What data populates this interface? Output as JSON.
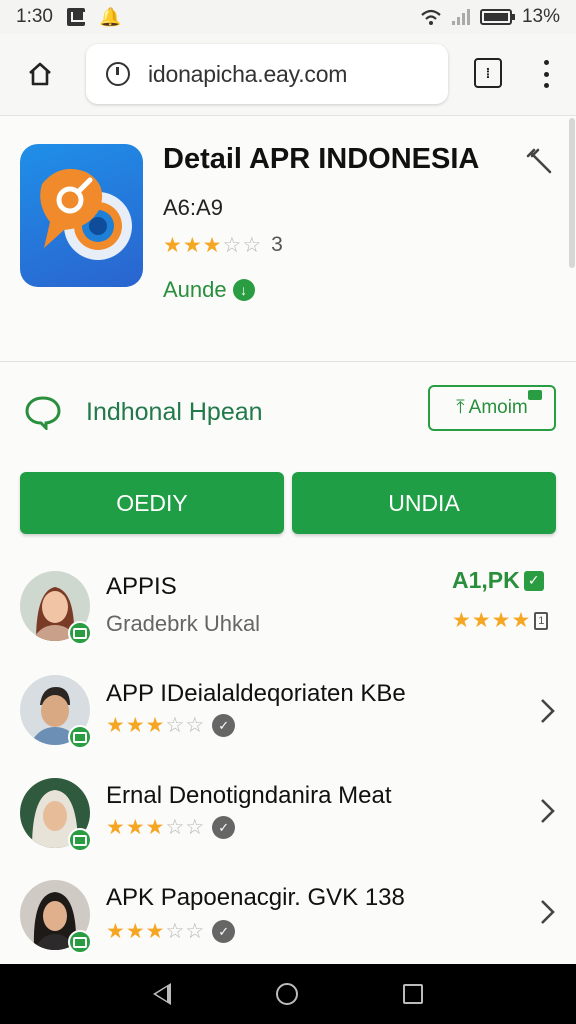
{
  "status_bar": {
    "time": "1:30",
    "battery": "13%"
  },
  "browser": {
    "url": "idonapicha.eay.com"
  },
  "app": {
    "title": "Detail APR INDONESIA",
    "subtitle": "A6:A9",
    "rating": 3,
    "rating_count": "3",
    "install_label": "Aunde"
  },
  "developer": {
    "name": "Indhonal Hpean",
    "share_label": "Amoim"
  },
  "buttons": {
    "primary_left": "OEDIY",
    "primary_right": "UNDIA"
  },
  "list": [
    {
      "title": "APPIS",
      "subtitle": "Gradebrk Uhkal",
      "price": "A1,PK",
      "rating": 4
    },
    {
      "title": "APP IDeialaldeqoriaten KBe",
      "rating": 3
    },
    {
      "title": "Ernal Denotigndanira Meat",
      "rating": 3
    },
    {
      "title": "APK Papoenacgir. GVK 138",
      "rating": 3
    }
  ],
  "colors": {
    "accent_green": "#1f9e45",
    "star": "#f5a623"
  },
  "icons": [
    "home-icon",
    "clock-icon",
    "tab-switcher-icon",
    "more-vert-icon",
    "edit-icon",
    "chat-icon",
    "share-icon",
    "verified-icon",
    "chevron-right-icon",
    "nav-back-icon",
    "nav-home-icon",
    "nav-recents-icon"
  ]
}
